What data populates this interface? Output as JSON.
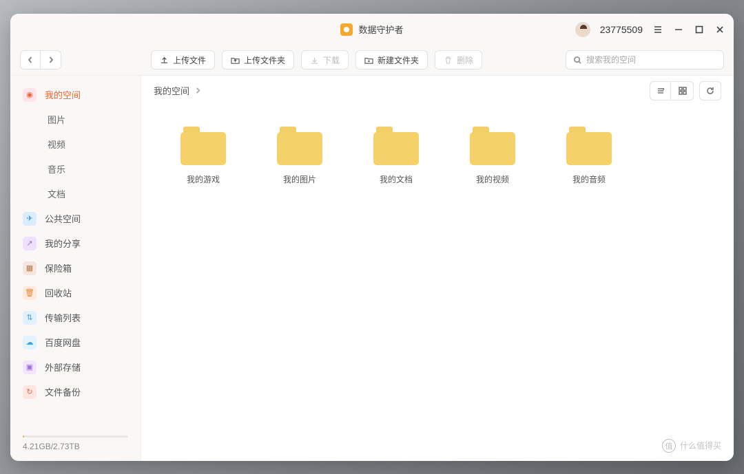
{
  "titlebar": {
    "app_name": "数据守护者",
    "user_id": "23775509"
  },
  "toolbar": {
    "upload_file": "上传文件",
    "upload_folder": "上传文件夹",
    "download": "下载",
    "new_folder": "新建文件夹",
    "delete": "删除"
  },
  "search": {
    "placeholder": "搜索我的空间"
  },
  "sidebar": {
    "items": [
      {
        "label": "我的空间",
        "active": true
      },
      {
        "label": "图片",
        "sub": true
      },
      {
        "label": "视频",
        "sub": true
      },
      {
        "label": "音乐",
        "sub": true
      },
      {
        "label": "文档",
        "sub": true
      },
      {
        "label": "公共空间"
      },
      {
        "label": "我的分享"
      },
      {
        "label": "保险箱"
      },
      {
        "label": "回收站"
      },
      {
        "label": "传输列表"
      },
      {
        "label": "百度网盘"
      },
      {
        "label": "外部存储"
      },
      {
        "label": "文件备份"
      }
    ],
    "storage_text": "4.21GB/2.73TB"
  },
  "breadcrumb": {
    "current": "我的空间"
  },
  "folders": [
    {
      "name": "我的游戏"
    },
    {
      "name": "我的图片"
    },
    {
      "name": "我的文档"
    },
    {
      "name": "我的视频"
    },
    {
      "name": "我的音频"
    }
  ],
  "watermark": "什么值得买"
}
